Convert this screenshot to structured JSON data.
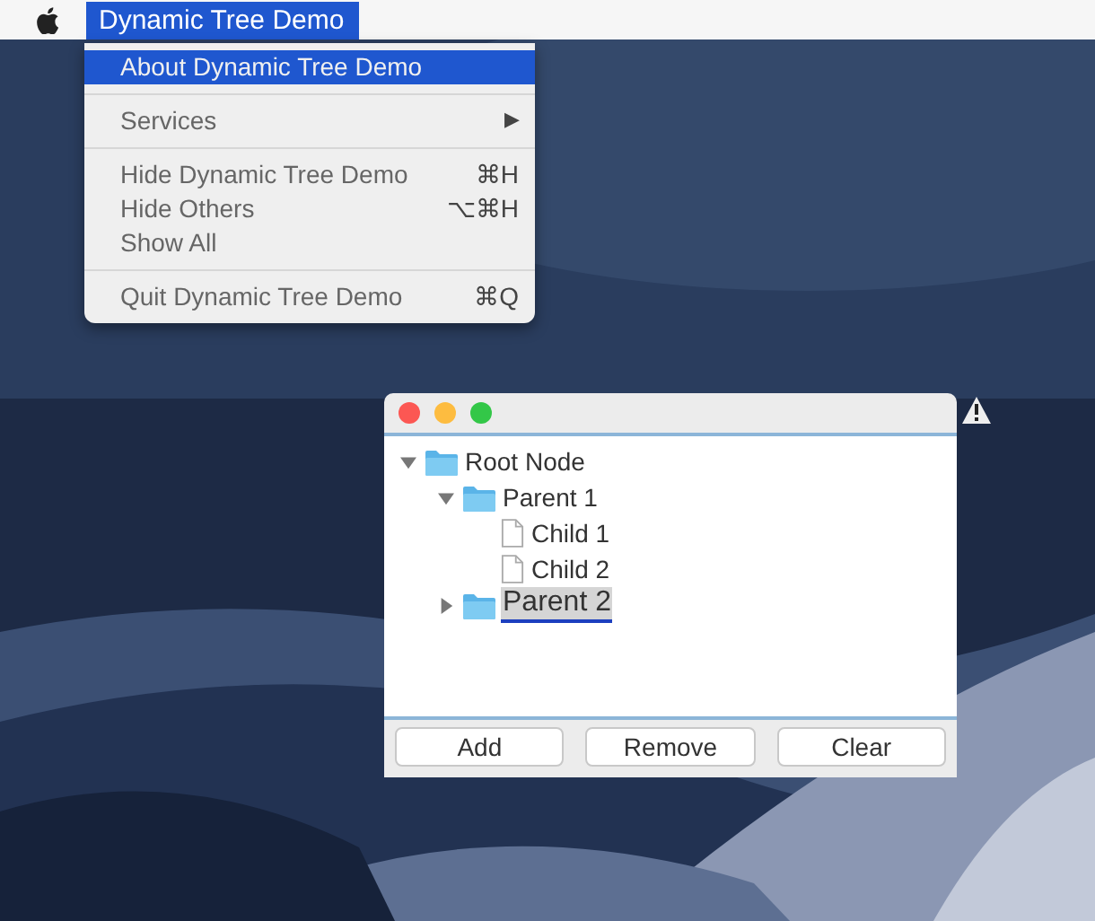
{
  "menu_bar": {
    "app_title": "Dynamic Tree Demo",
    "selected": true
  },
  "app_menu": {
    "sections": [
      [
        {
          "label": "About Dynamic Tree Demo",
          "selected": true
        }
      ],
      [
        {
          "label": "Services",
          "submenu": "▶",
          "selected": false
        }
      ],
      [
        {
          "label": "Hide Dynamic Tree Demo",
          "shortcut": "⌘H",
          "selected": false
        },
        {
          "label": "Hide Others",
          "shortcut": "⌥⌘H",
          "selected": false
        },
        {
          "label": "Show All",
          "selected": false
        }
      ],
      [
        {
          "label": "Quit Dynamic Tree Demo",
          "shortcut": "⌘Q",
          "selected": false
        }
      ]
    ]
  },
  "window": {
    "tree": [
      {
        "label": "Root Node",
        "kind": "folder",
        "expanded": true,
        "selected": false,
        "children": [
          {
            "label": "Parent 1",
            "kind": "folder",
            "expanded": true,
            "selected": false,
            "children": [
              {
                "label": "Child 1",
                "kind": "file",
                "selected": false
              },
              {
                "label": "Child 2",
                "kind": "file",
                "selected": false
              }
            ]
          },
          {
            "label": "Parent 2",
            "kind": "folder",
            "expanded": false,
            "selected": true
          }
        ]
      }
    ],
    "buttons": [
      "Add",
      "Remove",
      "Clear"
    ]
  }
}
